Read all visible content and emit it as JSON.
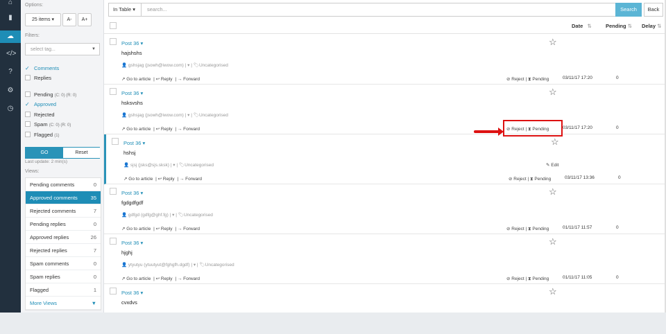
{
  "rail": {
    "icons": [
      "dashboard-icon",
      "bar-chart-icon",
      "cloud-icon",
      "code-icon",
      "help-icon",
      "gear-icon",
      "clock-icon"
    ]
  },
  "sidebar": {
    "options_label": "Options:",
    "items_select": "25 items",
    "font_smaller": "A-",
    "font_larger": "A+",
    "filters_label": "Filters:",
    "tag_placeholder": "select tag...",
    "type_filters": [
      {
        "label": "Comments",
        "checked": true
      },
      {
        "label": "Replies",
        "checked": false
      }
    ],
    "status_filters": [
      {
        "label": "Pending",
        "extra": "(C: 0) (R: 0)",
        "checked": false
      },
      {
        "label": "Approved",
        "extra": "",
        "checked": true
      },
      {
        "label": "Rejected",
        "extra": "",
        "checked": false
      },
      {
        "label": "Spam",
        "extra": "(C: 0) (R: 0)",
        "checked": false
      },
      {
        "label": "Flagged",
        "extra": "(1)",
        "checked": false
      }
    ],
    "go_label": "GO",
    "reset_label": "Reset",
    "last_update": "Last update: 2 min(s)",
    "views_label": "Views:",
    "views": [
      {
        "label": "Pending comments",
        "count": "0"
      },
      {
        "label": "Approved comments",
        "count": "35",
        "active": true
      },
      {
        "label": "Rejected comments",
        "count": "7"
      },
      {
        "label": "Pending replies",
        "count": "0"
      },
      {
        "label": "Approved replies",
        "count": "26"
      },
      {
        "label": "Rejected replies",
        "count": "7"
      },
      {
        "label": "Spam comments",
        "count": "0"
      },
      {
        "label": "Spam replies",
        "count": "0"
      },
      {
        "label": "Flagged",
        "count": "1"
      }
    ],
    "more_views": "More Views"
  },
  "search": {
    "scope": "In Table",
    "placeholder": "search...",
    "search_button": "Search",
    "back_button": "Back"
  },
  "table": {
    "col_date": "Date",
    "col_pending": "Pending",
    "col_delay": "Delay"
  },
  "rows": [
    {
      "post": "Post 36",
      "body": "hajshshs",
      "author": "gshsjag (jsowh@iwow.com)",
      "category": "Uncategorised",
      "date": "03/11/17 17:20",
      "pending": "0",
      "edit": false
    },
    {
      "post": "Post 36",
      "body": "hsksvshs",
      "author": "gshsjag (jsowh@iwow.com)",
      "category": "Uncategorised",
      "date": "03/11/17 17:20",
      "pending": "0",
      "edit": false
    },
    {
      "post": "Post 36",
      "body": "hshsj",
      "author": "sjsj (jsks@sjs.sksk)",
      "category": "Uncategorised",
      "date": "03/11/17 13:36",
      "pending": "0",
      "edit": true
    },
    {
      "post": "Post 36",
      "body": "fgdgdfgdf",
      "author": "gdfgd (gdfg@ghf.fg)",
      "category": "Uncategorised",
      "date": "01/11/17 11:57",
      "pending": "0",
      "edit": false
    },
    {
      "post": "Post 36",
      "body": "hjghj",
      "author": "ytyutyu (ytuutyut@fghgfh.dgdf)",
      "category": "Uncategorised",
      "date": "01/11/17 11:05",
      "pending": "0",
      "edit": false
    },
    {
      "post": "Post 36",
      "body": "cvxdvs",
      "author": "",
      "category": "",
      "date": "",
      "pending": "",
      "edit": false
    }
  ],
  "actions": {
    "go_to_article": "Go to article",
    "reply": "Reply",
    "forward": "Forward",
    "reject": "Reject",
    "pending": "Pending",
    "edit": "Edit"
  },
  "colors": {
    "accent": "#1e8db6",
    "rail": "#22303e",
    "highlight": "#dd1111"
  }
}
